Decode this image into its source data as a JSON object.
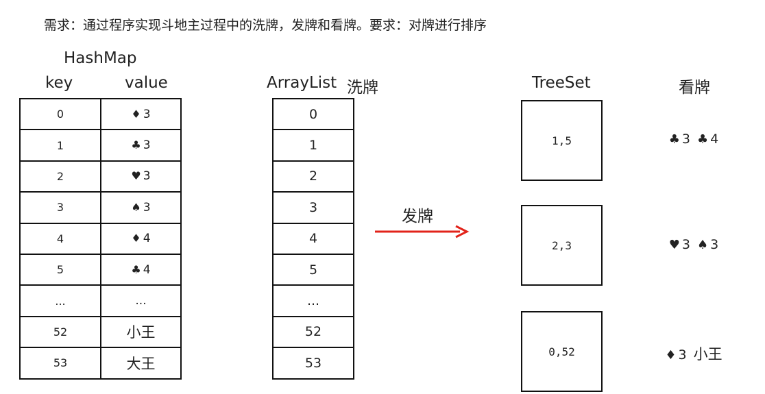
{
  "requirement": "需求：通过程序实现斗地主过程中的洗牌，发牌和看牌。要求：对牌进行排序",
  "hashmap": {
    "title": "HashMap",
    "key_header": "key",
    "value_header": "value",
    "rows": [
      {
        "key": "0",
        "suit": "♦",
        "value": "3"
      },
      {
        "key": "1",
        "suit": "♣",
        "value": "3"
      },
      {
        "key": "2",
        "suit": "♥",
        "value": "3"
      },
      {
        "key": "3",
        "suit": "♠",
        "value": "3"
      },
      {
        "key": "4",
        "suit": "♦",
        "value": "4"
      },
      {
        "key": "5",
        "suit": "♣",
        "value": "4"
      },
      {
        "key": "...",
        "suit": "",
        "value": "..."
      },
      {
        "key": "52",
        "suit": "",
        "value": "小王"
      },
      {
        "key": "53",
        "suit": "",
        "value": "大王"
      }
    ]
  },
  "arraylist": {
    "title": "ArrayList",
    "action": "洗牌",
    "items": [
      "0",
      "1",
      "2",
      "3",
      "4",
      "5",
      "...",
      "52",
      "53"
    ]
  },
  "deal": {
    "label": "发牌",
    "arrow_color": "#e2231a"
  },
  "treeset": {
    "title": "TreeSet",
    "boxes": [
      "1,5",
      "2,3",
      "0,52"
    ]
  },
  "view": {
    "title": "看牌",
    "hands": [
      [
        {
          "suit": "♣",
          "value": "3"
        },
        {
          "suit": "♣",
          "value": "4"
        }
      ],
      [
        {
          "suit": "♥",
          "value": "3"
        },
        {
          "suit": "♠",
          "value": "3"
        }
      ],
      [
        {
          "suit": "♦",
          "value": "3"
        },
        {
          "suit": "",
          "value": "小王"
        }
      ]
    ]
  }
}
